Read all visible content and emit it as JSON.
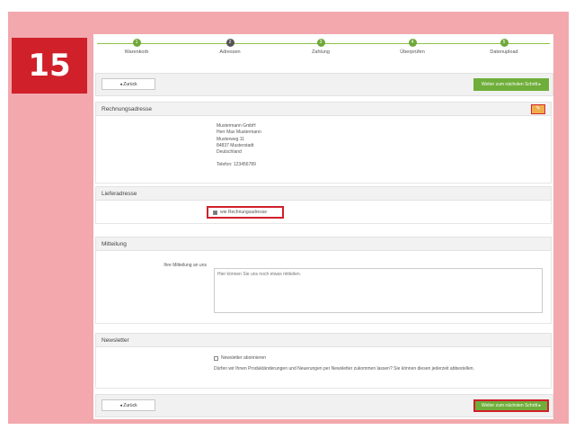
{
  "badge": "15",
  "progress": {
    "steps": [
      {
        "num": "1",
        "label": "Warenkorb"
      },
      {
        "num": "2",
        "label": "Adressen"
      },
      {
        "num": "3",
        "label": "Zahlung"
      },
      {
        "num": "4",
        "label": "Überprüfen"
      },
      {
        "num": "5",
        "label": "Datenupload"
      }
    ]
  },
  "nav": {
    "back_label": "◂ Zurück",
    "next_label": "Weiter zum nächsten Schritt ▸"
  },
  "billing": {
    "title": "Rechnungsadresse",
    "edit_icon": "pencil-icon",
    "lines": [
      "Mustermann GmbH",
      "Herr Max Mustermann",
      "Musterweg 11",
      "84837 Musterstadt",
      "Deutschland"
    ],
    "phone": "Telefon: 123456789"
  },
  "delivery": {
    "title": "Lieferadresse",
    "same_label": "wie Rechnungsadresse"
  },
  "message": {
    "title": "Mitteilung",
    "label": "Ihre Mitteilung an uns",
    "placeholder": "Hier können Sie uns noch etwas mitteilen."
  },
  "newsletter": {
    "title": "Newsletter",
    "checkbox_label": "Newsletter abonnieren",
    "text": "Dürfen wir Ihnen Produktänderungen und Neuerungen per Newsletter zukommen lassen? Sie können diesen jederzeit abbestellen."
  },
  "colors": {
    "accent": "#6fae3a",
    "highlight": "#d0202a",
    "edit": "#f0ad4e"
  }
}
